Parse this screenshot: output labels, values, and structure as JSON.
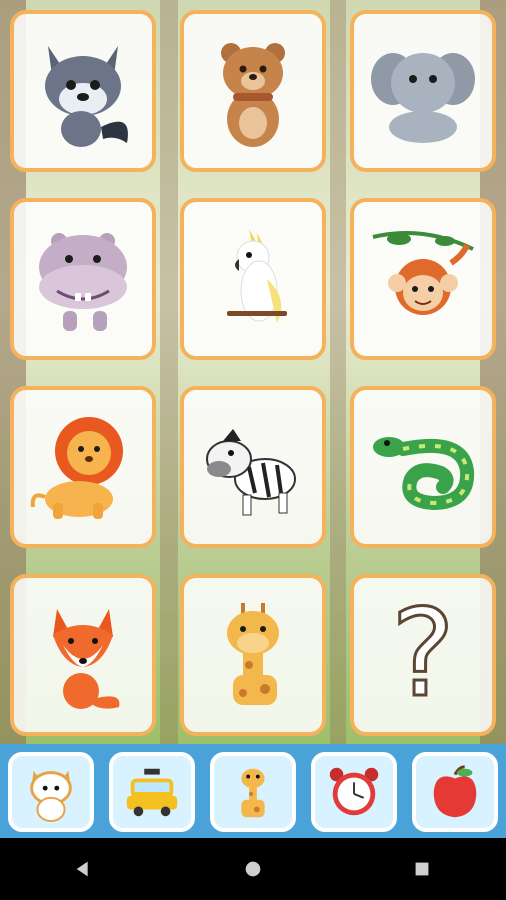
{
  "tiles": [
    {
      "name": "wolf",
      "label": ""
    },
    {
      "name": "bear",
      "label": ""
    },
    {
      "name": "elephant",
      "label": ""
    },
    {
      "name": "hippo",
      "label": ""
    },
    {
      "name": "cockatoo",
      "label": ""
    },
    {
      "name": "monkey",
      "label": ""
    },
    {
      "name": "lion",
      "label": ""
    },
    {
      "name": "zebra",
      "label": ""
    },
    {
      "name": "snake",
      "label": ""
    },
    {
      "name": "fox",
      "label": ""
    },
    {
      "name": "giraffe",
      "label": ""
    },
    {
      "name": "question-mark",
      "label": "?"
    }
  ],
  "categories": [
    {
      "name": "cat"
    },
    {
      "name": "taxi"
    },
    {
      "name": "giraffe"
    },
    {
      "name": "alarm-clock"
    },
    {
      "name": "apple"
    }
  ],
  "navigation": {
    "back": "back-icon",
    "home": "home-icon",
    "recents": "recents-icon"
  },
  "colors": {
    "tile_border": "#f4b25d",
    "bottom_bar": "#4aa3d8",
    "category_bg": "#d9f2ff"
  }
}
